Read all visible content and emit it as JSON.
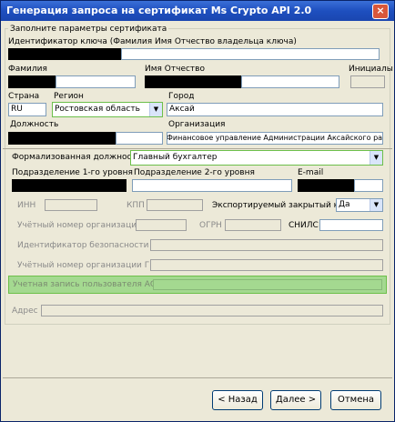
{
  "window": {
    "title": "Генерация запроса на сертификат Ms Crypto API 2.0",
    "close_glyph": "×"
  },
  "form": {
    "group_title": "Заполните параметры сертификата",
    "key_id_label": "Идентификатор ключа (Фамилия Имя Отчество владельца ключа)",
    "surname_label": "Фамилия",
    "name_label": "Имя Отчество",
    "initials_label": "Инициалы",
    "country_label": "Страна",
    "country_value": "RU",
    "region_label": "Регион",
    "region_value": "Ростовская область",
    "city_label": "Город",
    "city_value": "Аксай",
    "position_label": "Должность",
    "organization_label": "Организация",
    "organization_value": "Финансовое управление Администрации Аксайского района",
    "formal_position_label": "Формализованная должность",
    "formal_position_value": "Главный бухгалтер",
    "dept1_label": "Подразделение 1-го уровня",
    "dept2_label": "Подразделение 2-го уровня",
    "email_label": "E-mail",
    "inn_label": "ИНН",
    "kpp_label": "КПП",
    "export_key_label": "Экспортируемый закрытый ключ",
    "export_key_value": "Да",
    "spz_label": "Учётный номер организации СПЗ",
    "ogrn_label": "ОГРН",
    "snils_label": "СНИЛС",
    "security_id_label": "Идентификатор безопасности",
    "gmu_label": "Учётный номер организации ГМУ",
    "afk_label": "Учетная запись пользователя АСФК",
    "address_label": "Адрес"
  },
  "buttons": {
    "back": "< Назад",
    "next": "Далее >",
    "cancel": "Отмена"
  },
  "colors": {
    "highlight": "#a4d990",
    "titlebar": "#1e4fbf",
    "redacted": "#000000"
  }
}
